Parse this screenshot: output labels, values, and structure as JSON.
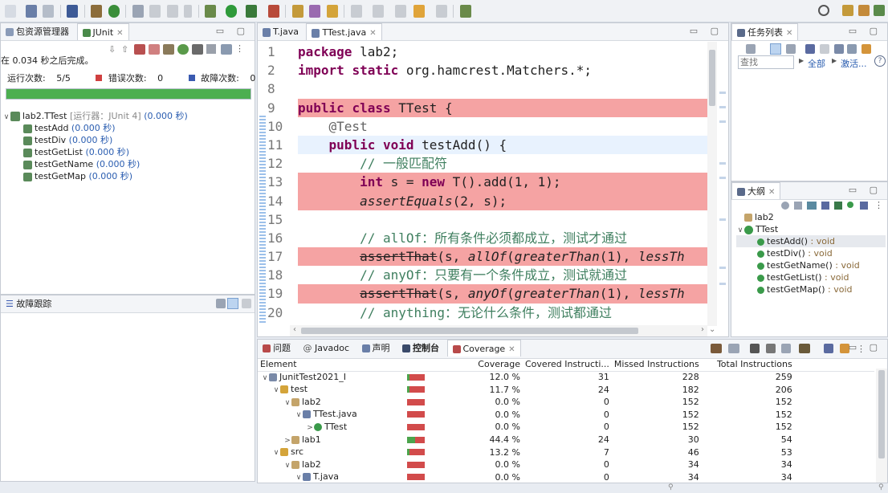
{
  "junit_panel": {
    "tabs": [
      "包资源管理器",
      "JUnit"
    ],
    "finished_text": "在 0.034 秒之后完成。",
    "runs_label": "运行次数:",
    "runs_value": "5/5",
    "errors_label": "错误次数:",
    "errors_value": "0",
    "failures_label": "故障次数:",
    "failures_value": "0",
    "progress": 1.0,
    "progress_color": "#4caf50",
    "suite": {
      "name": "lab2.TTest",
      "runner": "[运行器：JUnit 4]",
      "time": "(0.000 秒)"
    },
    "tests": [
      {
        "name": "testAdd",
        "time": "(0.000 秒)"
      },
      {
        "name": "testDiv",
        "time": "(0.000 秒)"
      },
      {
        "name": "testGetList",
        "time": "(0.000 秒)"
      },
      {
        "name": "testGetName",
        "time": "(0.000 秒)"
      },
      {
        "name": "testGetMap",
        "time": "(0.000 秒)"
      }
    ],
    "failure_trace_title": "故障跟踪"
  },
  "editor": {
    "tabs": [
      "T.java",
      "TTest.java"
    ],
    "lines": [
      {
        "n": "1",
        "parts": [
          {
            "t": "package",
            "c": "kw"
          },
          {
            "t": " lab2;",
            "c": ""
          }
        ]
      },
      {
        "n": "2",
        "parts": [
          {
            "t": "import",
            "c": "kw"
          },
          {
            "t": " ",
            "c": ""
          },
          {
            "t": "static",
            "c": "kw"
          },
          {
            "t": " org.hamcrest.Matchers.*;",
            "c": ""
          }
        ]
      },
      {
        "n": "8",
        "parts": []
      },
      {
        "n": "9",
        "parts": [
          {
            "t": "public",
            "c": "kw"
          },
          {
            "t": " ",
            "c": ""
          },
          {
            "t": "class",
            "c": "kw"
          },
          {
            "t": " TTest {",
            "c": ""
          }
        ]
      },
      {
        "n": "10",
        "parts": [
          {
            "t": "    @Test",
            "c": "gray"
          }
        ]
      },
      {
        "n": "11",
        "parts": [
          {
            "t": "    ",
            "c": ""
          },
          {
            "t": "public",
            "c": "kw"
          },
          {
            "t": " ",
            "c": ""
          },
          {
            "t": "void",
            "c": "kw"
          },
          {
            "t": " testAdd() {",
            "c": ""
          }
        ]
      },
      {
        "n": "12",
        "parts": [
          {
            "t": "        // 一般匹配符",
            "c": "cm"
          }
        ]
      },
      {
        "n": "13",
        "parts": [
          {
            "t": "        ",
            "c": ""
          },
          {
            "t": "int",
            "c": "kw"
          },
          {
            "t": " s = ",
            "c": ""
          },
          {
            "t": "new",
            "c": "kw"
          },
          {
            "t": " T().add(1, 1);",
            "c": ""
          }
        ]
      },
      {
        "n": "14",
        "parts": [
          {
            "t": "        ",
            "c": ""
          },
          {
            "t": "assertEquals",
            "c": "it"
          },
          {
            "t": "(2, s);",
            "c": ""
          }
        ]
      },
      {
        "n": "15",
        "parts": []
      },
      {
        "n": "16",
        "parts": [
          {
            "t": "        // allOf：所有条件必须都成立，测试才通过",
            "c": "cm"
          }
        ]
      },
      {
        "n": "17",
        "parts": [
          {
            "t": "        ",
            "c": ""
          },
          {
            "t": "assertThat",
            "c": "strike"
          },
          {
            "t": "(s, ",
            "c": ""
          },
          {
            "t": "allOf",
            "c": "it"
          },
          {
            "t": "(",
            "c": ""
          },
          {
            "t": "greaterThan",
            "c": "it"
          },
          {
            "t": "(1), ",
            "c": ""
          },
          {
            "t": "lessTh",
            "c": "it"
          }
        ]
      },
      {
        "n": "18",
        "parts": [
          {
            "t": "        // anyOf：只要有一个条件成立，测试就通过",
            "c": "cm"
          }
        ]
      },
      {
        "n": "19",
        "parts": [
          {
            "t": "        ",
            "c": ""
          },
          {
            "t": "assertThat",
            "c": "strike"
          },
          {
            "t": "(s, ",
            "c": ""
          },
          {
            "t": "anyOf",
            "c": "it"
          },
          {
            "t": "(",
            "c": ""
          },
          {
            "t": "greaterThan",
            "c": "it"
          },
          {
            "t": "(1), ",
            "c": ""
          },
          {
            "t": "lessTh",
            "c": "it"
          }
        ]
      },
      {
        "n": "20",
        "parts": [
          {
            "t": "        // anything：无论什么条件，测试都通过",
            "c": "cm"
          }
        ]
      }
    ],
    "highlight_color": "#f5a3a3",
    "current_line_color": "#e8f2fe"
  },
  "tasks_panel": {
    "title": "任务列表",
    "search_placeholder": "查找",
    "all_label": "全部",
    "activate_label": "激活..."
  },
  "outline_panel": {
    "title": "大纲",
    "package": "lab2",
    "class": "TTest",
    "methods": [
      {
        "name": "testAdd()",
        "type": ": void"
      },
      {
        "name": "testDiv()",
        "type": ": void"
      },
      {
        "name": "testGetName()",
        "type": ": void"
      },
      {
        "name": "testGetList()",
        "type": ": void"
      },
      {
        "name": "testGetMap()",
        "type": ": void"
      }
    ]
  },
  "bottom_panel": {
    "tabs": [
      "问题",
      "Javadoc",
      "声明",
      "控制台",
      "Coverage"
    ],
    "columns": [
      "Element",
      "Coverage",
      "Covered Instructi...",
      "Missed Instructions",
      "Total Instructions"
    ],
    "rows": [
      {
        "indent": 0,
        "twisty": "∨",
        "name": "JunitTest2021_I",
        "coverage": "12.0 %",
        "cov": 0.12,
        "covered": "31",
        "missed": "228",
        "total": "259"
      },
      {
        "indent": 1,
        "twisty": "∨",
        "name": "test",
        "coverage": "11.7 %",
        "cov": 0.117,
        "covered": "24",
        "missed": "182",
        "total": "206"
      },
      {
        "indent": 2,
        "twisty": "∨",
        "name": "lab2",
        "coverage": "0.0 %",
        "cov": 0.0,
        "covered": "0",
        "missed": "152",
        "total": "152"
      },
      {
        "indent": 3,
        "twisty": "∨",
        "name": "TTest.java",
        "coverage": "0.0 %",
        "cov": 0.0,
        "covered": "0",
        "missed": "152",
        "total": "152"
      },
      {
        "indent": 4,
        "twisty": ">",
        "name": "TTest",
        "coverage": "0.0 %",
        "cov": 0.0,
        "covered": "0",
        "missed": "152",
        "total": "152"
      },
      {
        "indent": 2,
        "twisty": ">",
        "name": "lab1",
        "coverage": "44.4 %",
        "cov": 0.444,
        "covered": "24",
        "missed": "30",
        "total": "54"
      },
      {
        "indent": 1,
        "twisty": "∨",
        "name": "src",
        "coverage": "13.2 %",
        "cov": 0.132,
        "covered": "7",
        "missed": "46",
        "total": "53"
      },
      {
        "indent": 2,
        "twisty": "∨",
        "name": "lab2",
        "coverage": "0.0 %",
        "cov": 0.0,
        "covered": "0",
        "missed": "34",
        "total": "34"
      },
      {
        "indent": 3,
        "twisty": "∨",
        "name": "T.java",
        "coverage": "0.0 %",
        "cov": 0.0,
        "covered": "0",
        "missed": "34",
        "total": "34"
      }
    ]
  }
}
